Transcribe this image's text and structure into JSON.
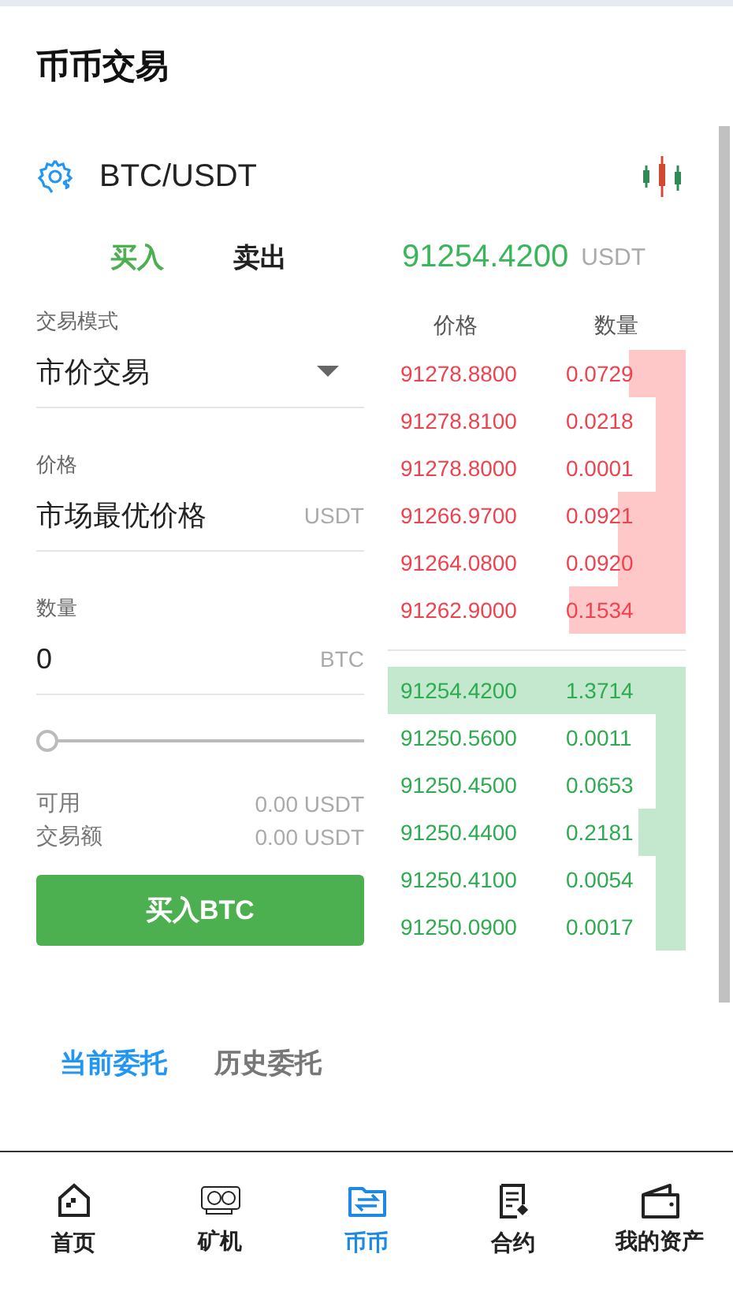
{
  "title": "币币交易",
  "pair": "BTC/USDT",
  "trade_tabs": [
    {
      "label": "买入",
      "selected": true
    },
    {
      "label": "卖出",
      "selected": false
    }
  ],
  "last_price": {
    "value": "91254.4200",
    "unit": "USDT"
  },
  "form": {
    "mode_label": "交易模式",
    "mode_value": "市价交易",
    "price_label": "价格",
    "price_value": "市场最优价格",
    "price_unit": "USDT",
    "amount_label": "数量",
    "amount_value": "0",
    "amount_unit": "BTC",
    "slider": {
      "level": 0
    },
    "summary": [
      {
        "label": "可用",
        "value": "0.00 USDT"
      },
      {
        "label": "交易额",
        "value": "0.00 USDT"
      }
    ],
    "submit": "买入BTC"
  },
  "order_book": {
    "columns": [
      "价格",
      "数量"
    ],
    "asks": [
      {
        "price": "91278.8800",
        "amount": "0.0729"
      },
      {
        "price": "91278.8100",
        "amount": "0.0218"
      },
      {
        "price": "91278.8000",
        "amount": "0.0001"
      },
      {
        "price": "91266.9700",
        "amount": "0.0921"
      },
      {
        "price": "91264.0800",
        "amount": "0.0920"
      },
      {
        "price": "91262.9000",
        "amount": "0.1534"
      }
    ],
    "bids": [
      {
        "price": "91254.4200",
        "amount": "1.3714"
      },
      {
        "price": "91250.5600",
        "amount": "0.0011"
      },
      {
        "price": "91250.4500",
        "amount": "0.0653"
      },
      {
        "price": "91250.4400",
        "amount": "0.2181"
      },
      {
        "price": "91250.4100",
        "amount": "0.0054"
      },
      {
        "price": "91250.0900",
        "amount": "0.0017"
      }
    ]
  },
  "order_tabs": [
    {
      "label": "当前委托",
      "selected": true
    },
    {
      "label": "历史委托",
      "selected": false
    }
  ],
  "nav": [
    {
      "label": "首页",
      "selected": false
    },
    {
      "label": "矿机",
      "selected": false
    },
    {
      "label": "币币",
      "selected": true
    },
    {
      "label": "合约",
      "selected": false
    },
    {
      "label": "我的资产",
      "selected": false
    }
  ]
}
